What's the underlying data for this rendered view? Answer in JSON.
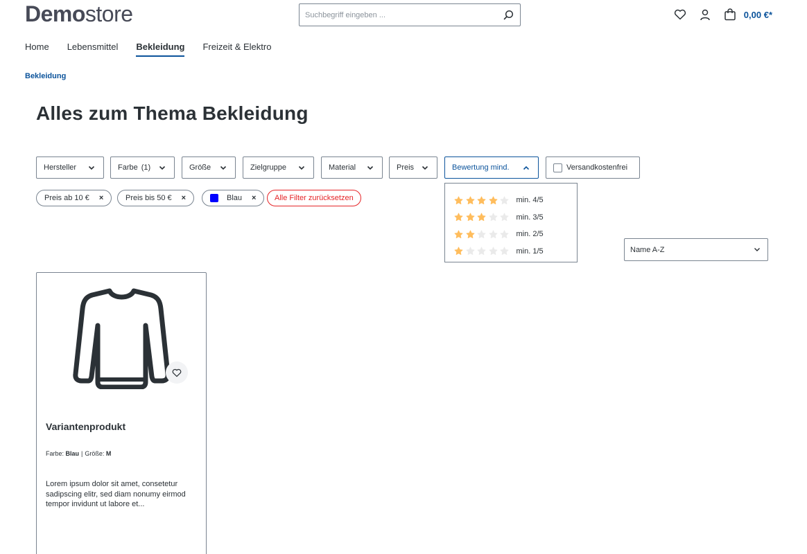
{
  "header": {
    "logo_bold": "Demo",
    "logo_light": "store",
    "search_placeholder": "Suchbegriff eingeben ...",
    "cart_total": "0,00 €*"
  },
  "nav": {
    "items": [
      {
        "label": "Home"
      },
      {
        "label": "Lebensmittel"
      },
      {
        "label": "Bekleidung",
        "active": true
      },
      {
        "label": "Freizeit & Elektro"
      }
    ]
  },
  "breadcrumb": "Bekleidung",
  "page_title": "Alles zum Thema Bekleidung",
  "filters": [
    {
      "label": "Hersteller"
    },
    {
      "label": "Farbe",
      "count": "(1)"
    },
    {
      "label": "Größe"
    },
    {
      "label": "Zielgruppe"
    },
    {
      "label": "Material"
    },
    {
      "label": "Preis"
    },
    {
      "label": "Bewertung mind.",
      "open": true
    },
    {
      "label": "Versandkostenfrei"
    }
  ],
  "rating_options": [
    {
      "label": "min. 4/5",
      "stars": 4
    },
    {
      "label": "min. 3/5",
      "stars": 3
    },
    {
      "label": "min. 2/5",
      "stars": 2
    },
    {
      "label": "min. 1/5",
      "stars": 1
    }
  ],
  "active_filters": [
    {
      "label": "Preis ab 10 €",
      "remove": "×"
    },
    {
      "label": "Preis bis 50 €",
      "remove": "×"
    },
    {
      "label": "Blau",
      "remove": "×",
      "swatch_color": "#0000ff"
    }
  ],
  "reset_label": "Alle Filter zurücksetzen",
  "sort": {
    "selected": "Name A-Z"
  },
  "product": {
    "name": "Variantenprodukt",
    "variant_color_label": "Farbe:",
    "variant_color_value": "Blau",
    "variant_separator": "|",
    "variant_size_label": "Größe:",
    "variant_size_value": "M",
    "description": "Lorem ipsum dolor sit amet, consetetur sadipscing elitr, sed diam nonumy eirmod tempor invidunt ut labore et..."
  },
  "colors": {
    "accent": "#0b539b",
    "star_filled": "#ffbd5d",
    "star_empty": "#eaeaea",
    "reset": "#e52427",
    "border": "#798490"
  }
}
